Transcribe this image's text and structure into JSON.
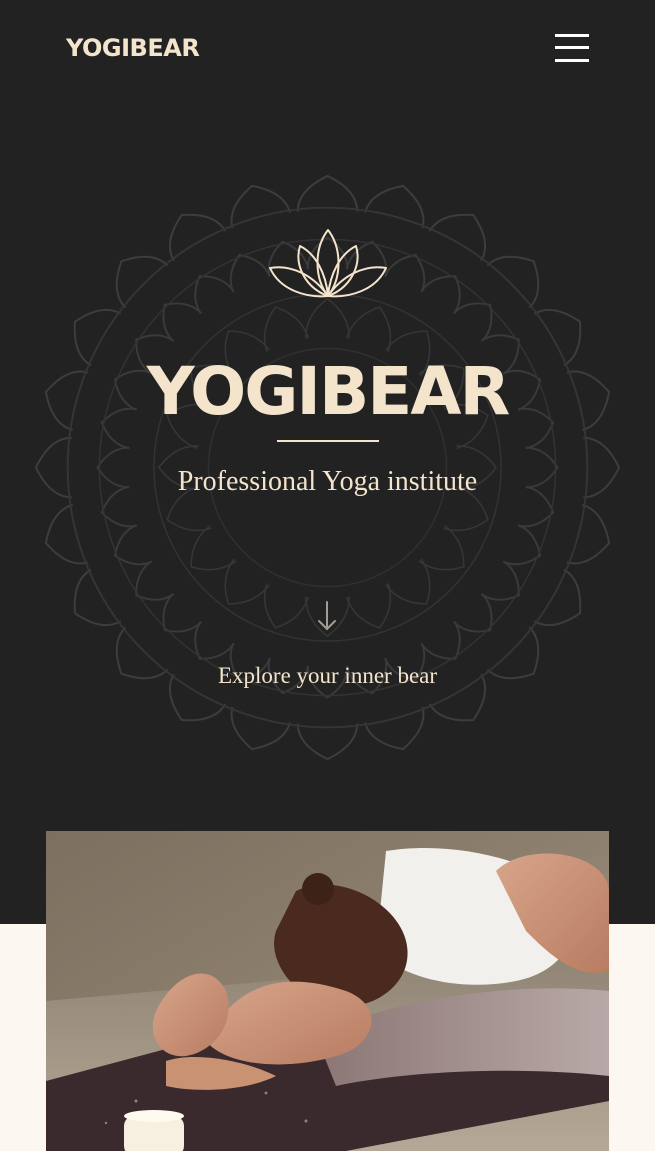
{
  "header": {
    "logo_text": "YOGIBEAR",
    "menu_icon": "hamburger-menu-icon"
  },
  "hero": {
    "lotus_icon": "lotus-icon",
    "title": "YOGIBEAR",
    "subtitle": "Professional Yoga institute",
    "arrow_icon": "arrow-down-icon",
    "cta": "Explore your inner bear"
  },
  "photo": {
    "subject": "woman stretching on yoga mat"
  },
  "colors": {
    "background": "#222223",
    "accent": "#f4e4cc",
    "cream": "#fcf8f1"
  }
}
